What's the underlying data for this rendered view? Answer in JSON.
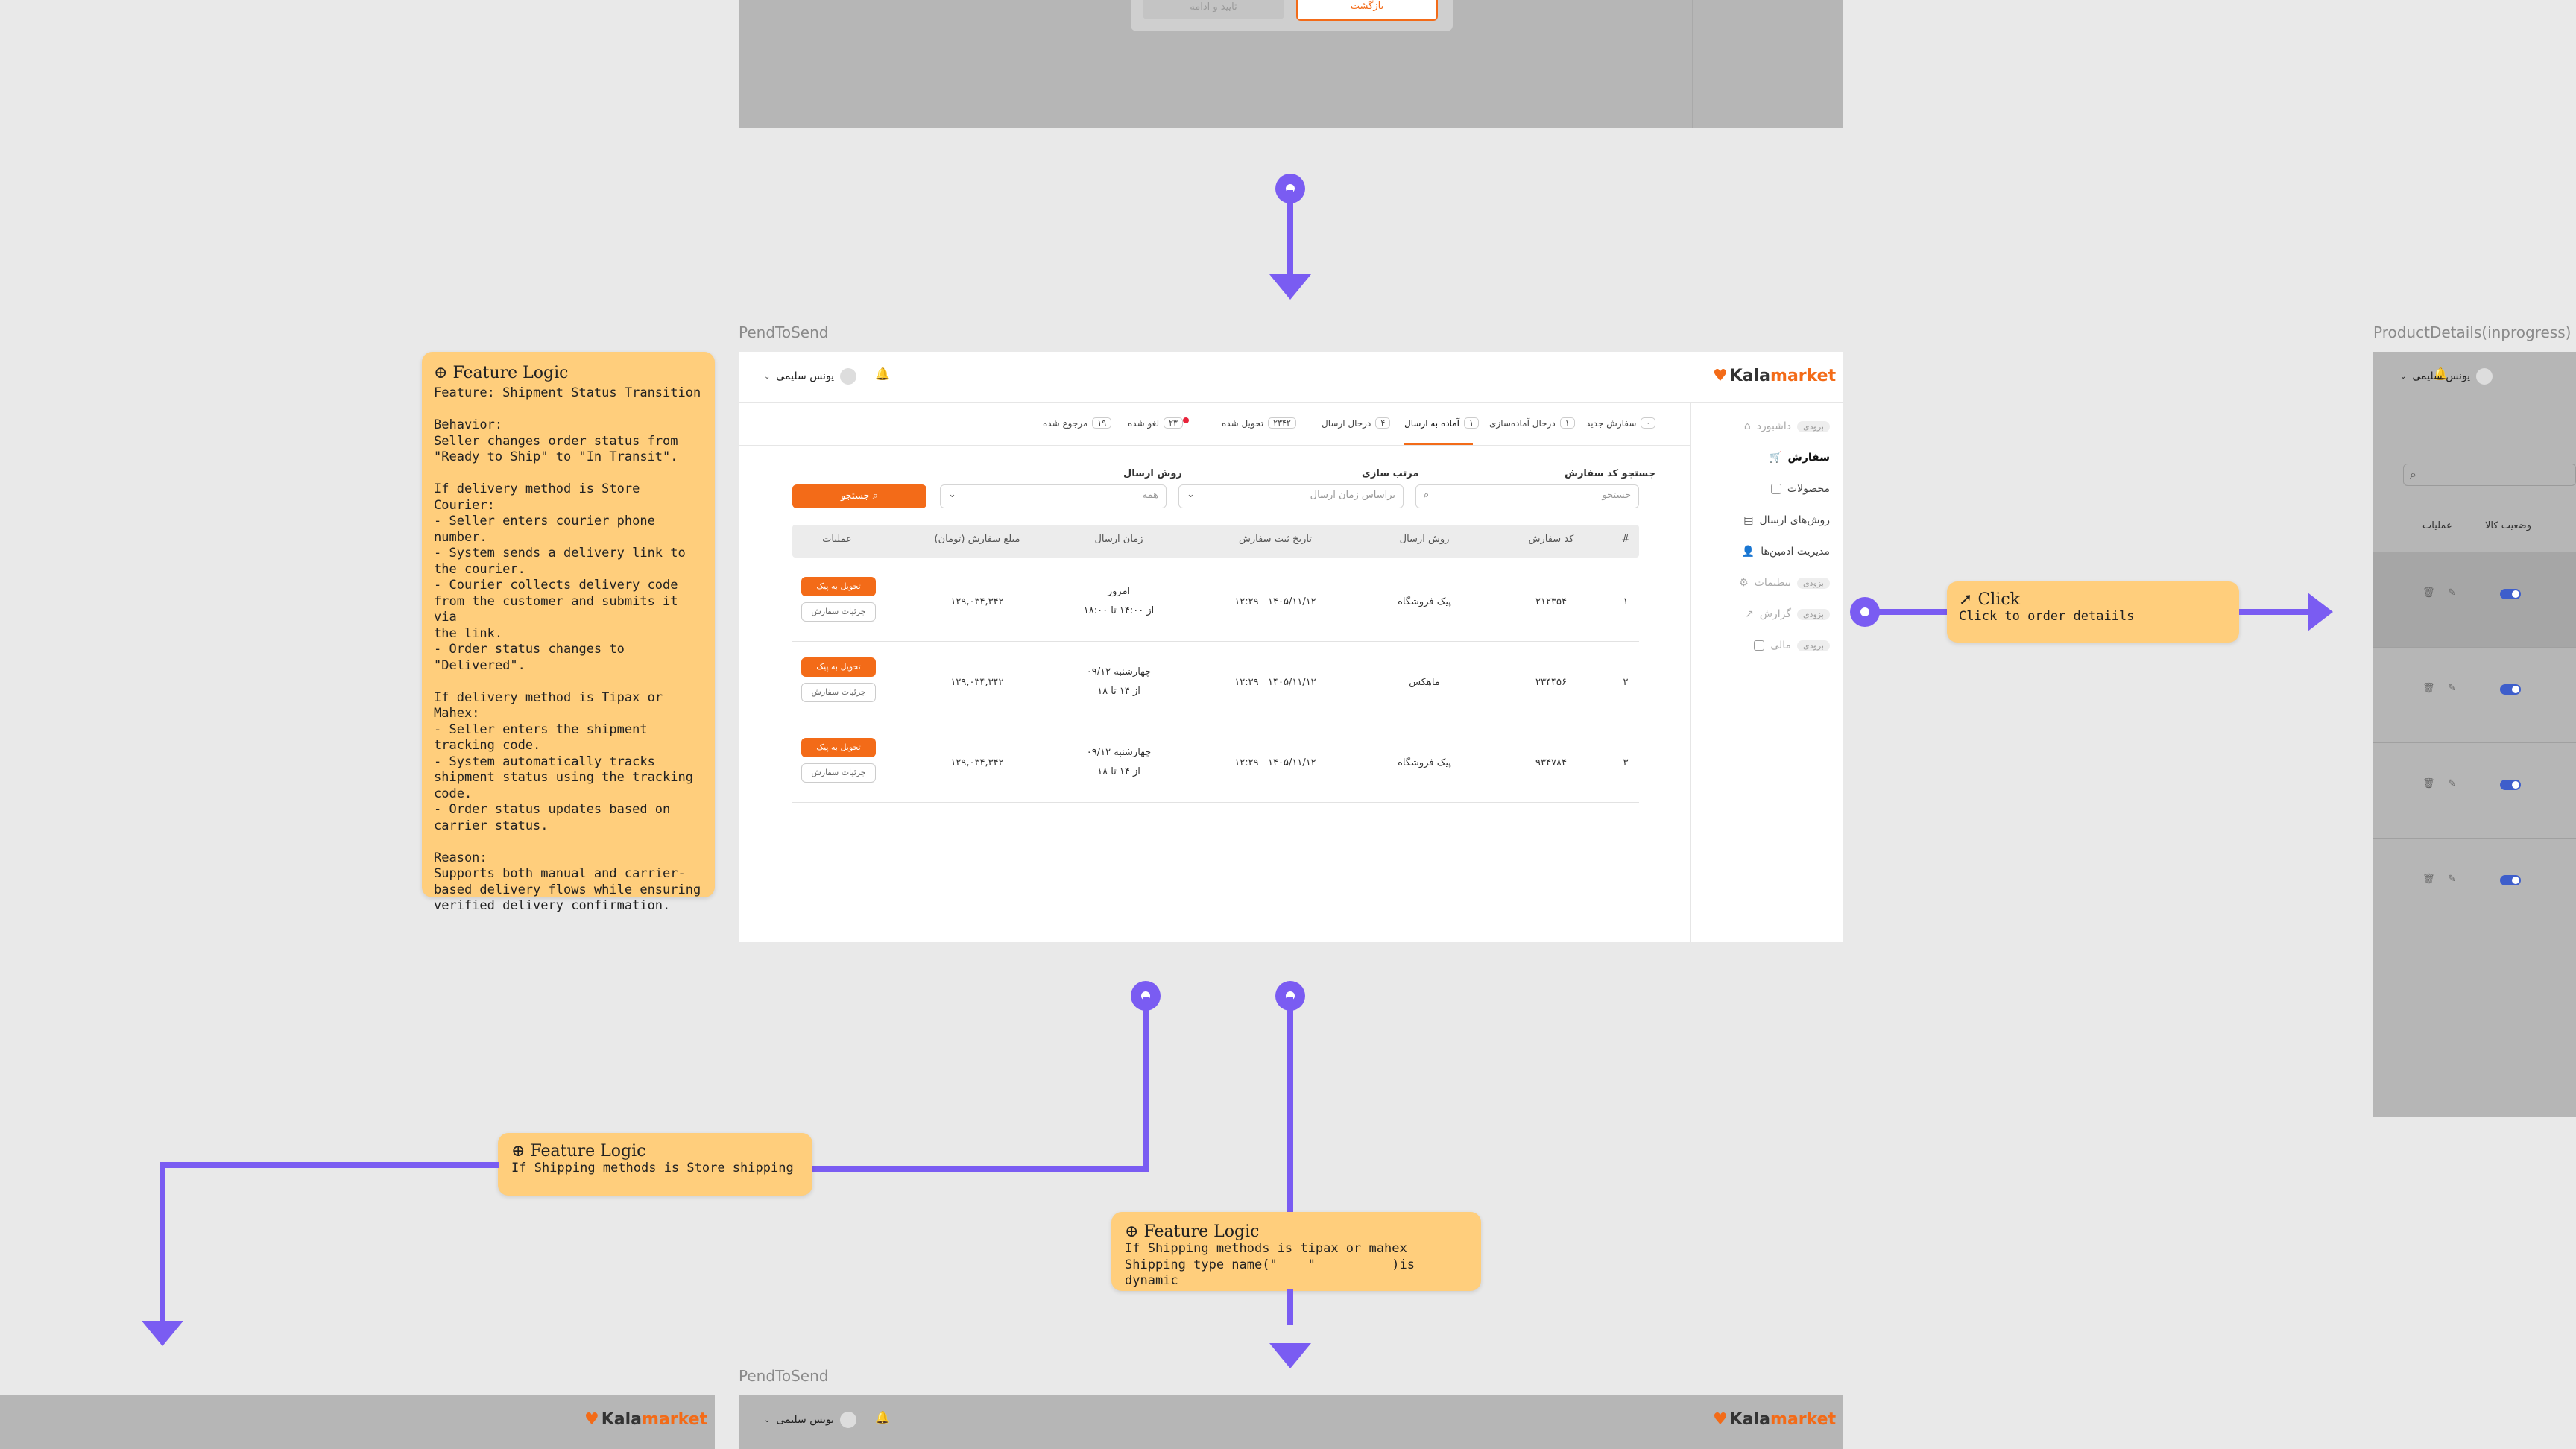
{
  "top_frame": {
    "confirm_button": "تایید و ادامه",
    "back_button": "بازگشت"
  },
  "frames": {
    "main_label": "PendToSend",
    "bottom_label": "PendToSend",
    "right_label": "ProductDetails(inprogress)"
  },
  "brand": {
    "logo_text": "Kala",
    "logo_accent": "market",
    "accent_color": "#f36b18",
    "connector_color": "#7a5cf2",
    "note_color": "#ffce7c"
  },
  "header": {
    "user_name": "یونس سلیمی",
    "bell_icon": "bell-icon"
  },
  "sidebar": {
    "items": [
      {
        "label": "داشبورد",
        "badge": "بزودی",
        "icon": "home-icon"
      },
      {
        "label": "سفارش",
        "badge": "",
        "icon": "cart-icon"
      },
      {
        "label": "محصولات",
        "badge": "",
        "icon": "box-icon"
      },
      {
        "label": "روش‌های ارسال",
        "badge": "",
        "icon": "truck-icon"
      },
      {
        "label": "مدیریت ادمین‌ها",
        "badge": "",
        "icon": "user-icon"
      },
      {
        "label": "تنظیمات",
        "badge": "بزودی",
        "icon": "gear-icon"
      },
      {
        "label": "گزارش",
        "badge": "بزودی",
        "icon": "chart-icon"
      },
      {
        "label": "مالی",
        "badge": "بزودی",
        "icon": "wallet-icon"
      }
    ]
  },
  "tabs": [
    {
      "label": "سفارش جدید",
      "count": "۰"
    },
    {
      "label": "درحال آماده‌سازی",
      "count": "۱"
    },
    {
      "label": "آماده به ارسال",
      "count": "۱"
    },
    {
      "label": "درحال ارسال",
      "count": "۴"
    },
    {
      "label": "تحویل شده",
      "count": "۲۳۴۲"
    },
    {
      "label": "لغو شده",
      "count": "۲۳"
    },
    {
      "label": "مرجوع شده",
      "count": "۱۹"
    }
  ],
  "filters": {
    "search_label": "جستجو کد سفارش",
    "search_placeholder": "جستجو",
    "sort_label": "مرتب سازی",
    "sort_value": "براساس زمان ارسال",
    "method_label": "روش ارسال",
    "method_value": "همه",
    "search_button": "جستجو"
  },
  "table": {
    "headers": [
      "#",
      "کد سفارش",
      "روش ارسال",
      "تاریخ ثبت سفارش",
      "زمان ارسال",
      "مبلغ سفارش (تومان)",
      "عملیات"
    ],
    "rows": [
      {
        "n": "۱",
        "code": "۲۱۲۳۵۴",
        "method": "پیک فروشگاه",
        "date": "۱۴۰۵/۱۱/۱۲   ۱۲:۲۹",
        "time1": "امروز",
        "time2": "از ۱۴:۰۰ تا ۱۸:۰۰",
        "amount": "۱۲۹,۰۳۴,۳۴۲"
      },
      {
        "n": "۲",
        "code": "۲۳۴۴۵۶",
        "method": "ماهکس",
        "date": "۱۴۰۵/۱۱/۱۲   ۱۲:۲۹",
        "time1": "چهارشنبه ۰۹/۱۲",
        "time2": "از ۱۴ تا ۱۸",
        "amount": "۱۲۹,۰۳۴,۳۴۲"
      },
      {
        "n": "۳",
        "code": "۹۳۴۷۸۴",
        "method": "پیک فروشگاه",
        "date": "۱۴۰۵/۱۱/۱۲   ۱۲:۲۹",
        "time1": "چهارشنبه ۰۹/۱۲",
        "time2": "از ۱۴ تا ۱۸",
        "amount": "۱۲۹,۰۳۴,۳۴۲"
      }
    ],
    "action_primary": "تحویل به پیک",
    "action_secondary": "جزئیات سفارش"
  },
  "right_panel": {
    "col_status": "وضعیت کالا",
    "col_actions": "عملیات",
    "row_count": 4
  },
  "notes": {
    "main": {
      "title": "Feature Logic",
      "body": "Feature: Shipment Status Transition\n\nBehavior:\nSeller changes order status from\n\"Ready to Ship\" to \"In Transit\".\n\nIf delivery method is Store Courier:\n- Seller enters courier phone\nnumber.\n- System sends a delivery link to\nthe courier.\n- Courier collects delivery code\nfrom the customer and submits it via\nthe link.\n- Order status changes to\n\"Delivered\".\n\nIf delivery method is Tipax or\nMahex:\n- Seller enters the shipment\ntracking code.\n- System automatically tracks\nshipment status using the tracking\ncode.\n- Order status updates based on\ncarrier status.\n\nReason:\nSupports both manual and carrier-\nbased delivery flows while ensuring\nverified delivery confirmation."
    },
    "click": {
      "title": "Click",
      "body": "Click to order detaiils"
    },
    "store": {
      "title": "Feature Logic",
      "body": "If Shipping methods is Store shipping"
    },
    "tipax": {
      "title": "Feature Logic",
      "body": "If Shipping methods is tipax or mahex\nShipping type name(\"    \"          )is dynamic"
    }
  }
}
